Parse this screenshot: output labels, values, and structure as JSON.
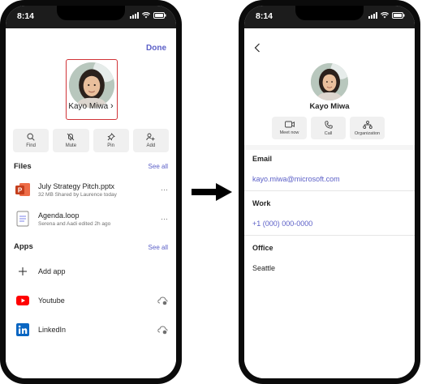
{
  "left": {
    "status_time": "8:14",
    "done_label": "Done",
    "profile_name": "Kayo Miwa",
    "profile_chevron": "›",
    "actions": [
      {
        "label": "Find",
        "icon": "search-icon"
      },
      {
        "label": "Mute",
        "icon": "bell-off-icon"
      },
      {
        "label": "Pin",
        "icon": "pin-icon"
      },
      {
        "label": "Add",
        "icon": "add-person-icon"
      }
    ],
    "files_title": "Files",
    "files_see_all": "See all",
    "files": [
      {
        "title": "July Strategy Pitch.pptx",
        "subtitle": "32 MB Shared by Laurence today",
        "icon": "powerpoint-icon"
      },
      {
        "title": "Agenda.loop",
        "subtitle": "Serena and Aadi edited 2h ago",
        "icon": "loop-icon"
      }
    ],
    "apps_title": "Apps",
    "apps_see_all": "See all",
    "apps": [
      {
        "title": "Add app",
        "icon": "plus-icon"
      },
      {
        "title": "Youtube",
        "icon": "youtube-icon"
      },
      {
        "title": "LinkedIn",
        "icon": "linkedin-icon"
      }
    ],
    "more_glyph": "···"
  },
  "right": {
    "status_time": "8:14",
    "profile_name": "Kayo Miwa",
    "actions": [
      {
        "label": "Meet now",
        "icon": "video-icon"
      },
      {
        "label": "Call",
        "icon": "phone-icon"
      },
      {
        "label": "Organization",
        "icon": "org-chart-icon"
      }
    ],
    "email_label": "Email",
    "email_value": "kayo.miwa@microsoft.com",
    "work_label": "Work",
    "work_value": "+1 (000) 000-0000",
    "office_label": "Office",
    "office_value": "Seattle"
  },
  "colors": {
    "accent": "#5b5fc7",
    "highlight_border": "#d13438",
    "powerpoint": "#c43e1c",
    "youtube": "#ff0000",
    "linkedin": "#0a66c2"
  }
}
